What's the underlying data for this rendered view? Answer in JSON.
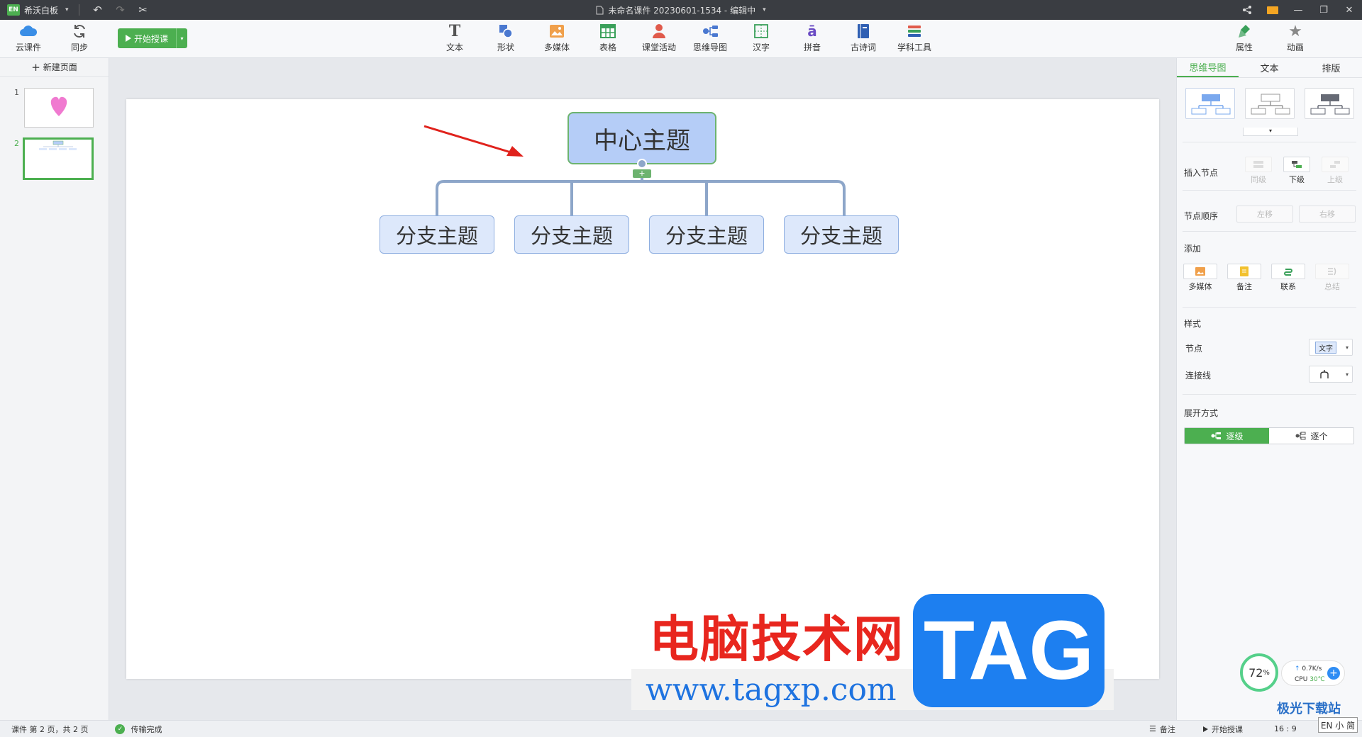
{
  "titlebar": {
    "logo_badge": "EN",
    "app_name": "希沃白板",
    "doc_title": "未命名课件 20230601-1534 - 编辑中"
  },
  "toolbar": {
    "cloud_label": "云课件",
    "sync_label": "同步",
    "start_label": "开始授课",
    "tools": [
      {
        "label": "文本",
        "icon": "text-icon"
      },
      {
        "label": "形状",
        "icon": "shape-icon"
      },
      {
        "label": "多媒体",
        "icon": "image-icon"
      },
      {
        "label": "表格",
        "icon": "table-icon"
      },
      {
        "label": "课堂活动",
        "icon": "activity-icon"
      },
      {
        "label": "思维导图",
        "icon": "mindmap-icon"
      },
      {
        "label": "汉字",
        "icon": "hanzi-icon"
      },
      {
        "label": "拼音",
        "icon": "pinyin-icon"
      },
      {
        "label": "古诗词",
        "icon": "poetry-icon"
      },
      {
        "label": "学科工具",
        "icon": "subject-tools-icon"
      }
    ],
    "properties_label": "属性",
    "animation_label": "动画"
  },
  "pages": {
    "new_page_label": "新建页面",
    "items": [
      {
        "number": "1"
      },
      {
        "number": "2"
      }
    ]
  },
  "mindmap": {
    "center": "中心主题",
    "branches": [
      "分支主题",
      "分支主题",
      "分支主题",
      "分支主题"
    ]
  },
  "watermark": {
    "cn": "电脑技术网",
    "url": "www.tagxp.com",
    "tag": "TAG"
  },
  "rpanel": {
    "tabs": [
      "思维导图",
      "文本",
      "排版"
    ],
    "insert_node_label": "插入节点",
    "insert_buttons": [
      "同级",
      "下级",
      "上级"
    ],
    "node_order_label": "节点顺序",
    "order_buttons": [
      "左移",
      "右移"
    ],
    "add_label": "添加",
    "add_buttons": [
      "多媒体",
      "备注",
      "联系",
      "总结"
    ],
    "style_label": "样式",
    "node_label": "节点",
    "node_select": "文字",
    "connector_label": "连接线",
    "expand_label": "展开方式",
    "expand_options": [
      "逐级",
      "逐个"
    ]
  },
  "status": {
    "page_info": "课件 第 2 页，共 2 页",
    "transfer": "传输完成",
    "notes": "备注",
    "start": "开始授课",
    "ratio": "16 : 9"
  },
  "overlay": {
    "perf_percent": "72",
    "perf_unit": "%",
    "net_speed": "0.7K/s",
    "cpu_label": "CPU",
    "cpu_temp": "30℃",
    "site_logo": "极光下载站",
    "ime": "EN 小 简"
  },
  "colors": {
    "accent": "#4caf50",
    "title_bar": "#3a3d42",
    "node_center_fill": "#b5cdf7",
    "node_branch_fill": "#dde8fb",
    "connector": "#8da6c9",
    "arrow": "#e0221c"
  }
}
